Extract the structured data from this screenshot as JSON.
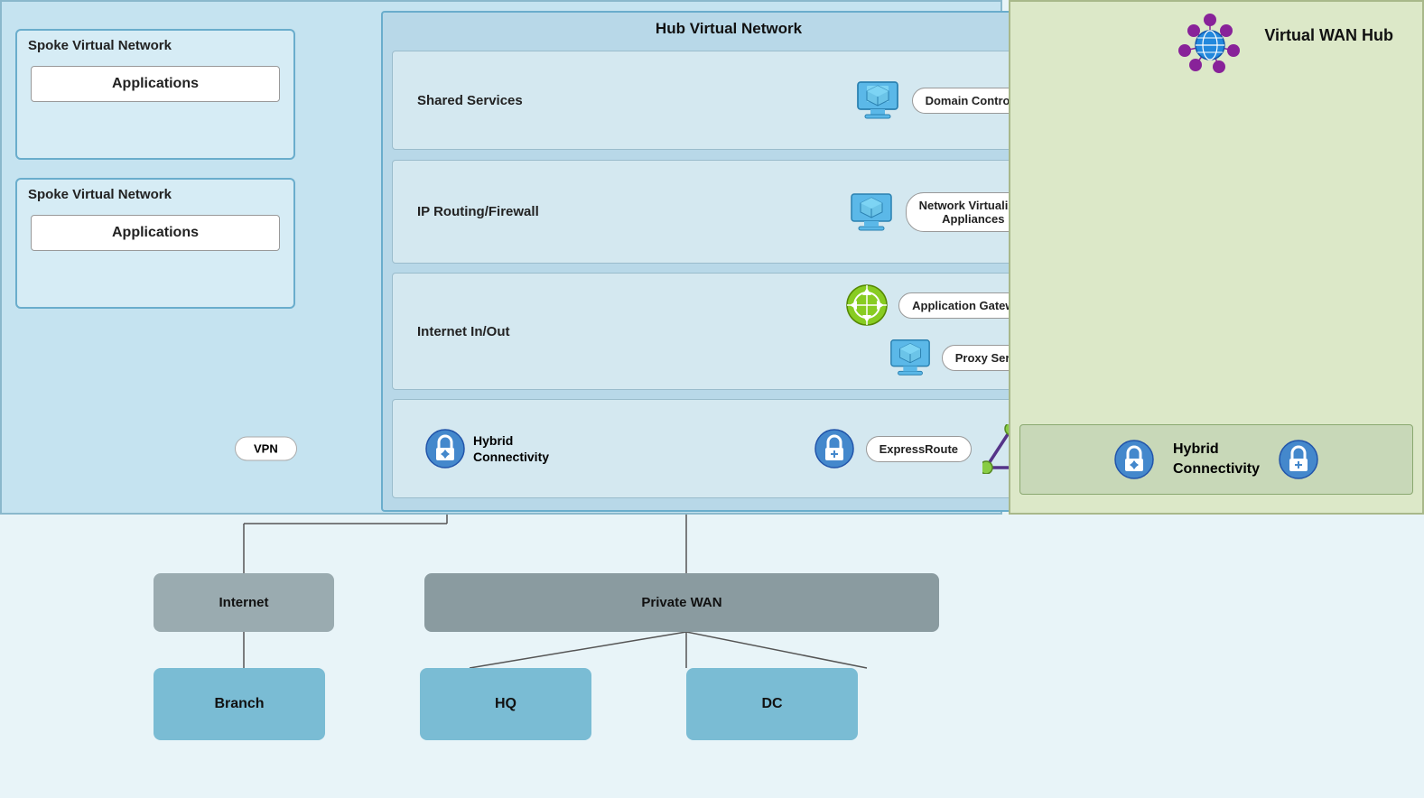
{
  "spoke1": {
    "title": "Spoke Virtual Network",
    "app_label": "Applications"
  },
  "spoke2": {
    "title": "Spoke Virtual Network",
    "app_label": "Applications"
  },
  "hub": {
    "title": "Hub Virtual Network",
    "sections": {
      "shared": {
        "label": "Shared Services",
        "service": "Domain Controller"
      },
      "ip": {
        "label": "IP Routing/Firewall",
        "service": "Network  Virtualized\nAppliances"
      },
      "internet": {
        "label": "Internet In/Out",
        "service1": "Application Gateway",
        "service2": "Proxy Server"
      },
      "hybrid": {
        "label": "Hybrid Connectivity",
        "service": "ExpressRoute"
      }
    }
  },
  "vpn": {
    "label": "VPN"
  },
  "wan_hub": {
    "title": "Virtual WAN Hub",
    "hybrid_label": "Hybrid\nConnectivity"
  },
  "bottom": {
    "internet": "Internet",
    "private_wan": "Private WAN",
    "branch": "Branch",
    "hq": "HQ",
    "dc": "DC"
  }
}
